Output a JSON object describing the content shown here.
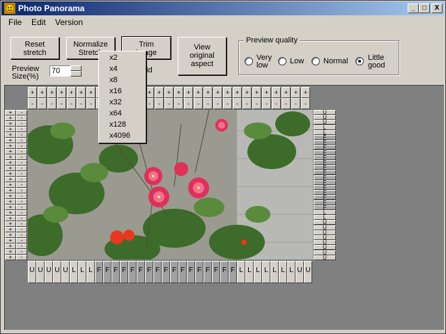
{
  "window": {
    "title": "Photo Panorama",
    "caption_minimize": "_",
    "caption_maximize": "□",
    "caption_close": "X"
  },
  "menu": [
    "File",
    "Edit",
    "Version"
  ],
  "toolbar": {
    "reset_label": "Reset\nstretch",
    "normalize_label": "Normalize\nStretch",
    "trim_label": "Trim\nimage",
    "view_label": "View\noriginal\naspect",
    "preview_size_label": "Preview\nSize(%)",
    "preview_size_value": "70",
    "hidden_fragment": "id"
  },
  "preview_quality": {
    "label": "Preview quality",
    "options": [
      "Very\nlow",
      "Low",
      "Normal",
      "Little\ngood"
    ],
    "selected": "Little\ngood"
  },
  "dropdown": {
    "items": [
      "x2",
      "x4",
      "x8",
      "x16",
      "x32",
      "x64",
      "x128",
      "x4096"
    ]
  },
  "top_handles": {
    "plus": "+",
    "minus": "-",
    "count": 29
  },
  "left_handles": {
    "plus": "+",
    "minus": "-",
    "rows": 27
  },
  "right_handles": {
    "labels": [
      "U",
      "U",
      "U",
      "L",
      "L",
      "F",
      "F",
      "F",
      "F",
      "F",
      "F",
      "F",
      "F",
      "F",
      "F",
      "F",
      "F",
      "F",
      "F",
      "F",
      "L",
      "L",
      "U",
      "U",
      "U",
      "U",
      "U",
      "U",
      "U",
      "U"
    ]
  },
  "bottom_handles": {
    "labels": [
      "U",
      "U",
      "U",
      "U",
      "U",
      "L",
      "L",
      "L",
      "F",
      "F",
      "F",
      "F",
      "F",
      "F",
      "F",
      "F",
      "F",
      "F",
      "F",
      "F",
      "F",
      "F",
      "F",
      "F",
      "F",
      "L",
      "L",
      "L",
      "L",
      "L",
      "L",
      "L",
      "U",
      "U"
    ],
    "dark_from": 8,
    "dark_to": 24
  },
  "colors": {
    "titlebar_start": "#0a246a",
    "titlebar_end": "#a6caf0",
    "workspace": "#808080",
    "face": "#d4d0c8"
  }
}
